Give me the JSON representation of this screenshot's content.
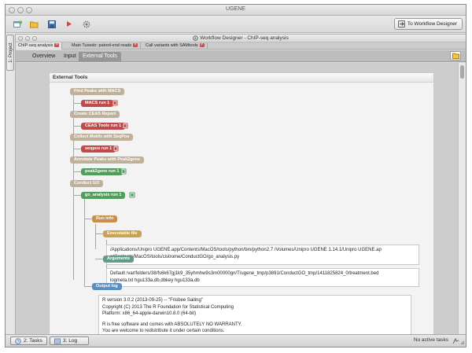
{
  "app": {
    "title": "UGENE"
  },
  "toolbar": {
    "to_wd_label": "To Workflow Designer"
  },
  "side": {
    "project_tab": "1: Project"
  },
  "workflow_window": {
    "title": "Workflow Designer - ChIP-seq analysis",
    "doc_tabs": [
      {
        "label": "ChIP-seq analysis"
      },
      {
        "label": "Main Tuxedo: paired-end reads"
      },
      {
        "label": "Call variants with SAMtools"
      }
    ],
    "view_tabs": [
      "Overview",
      "Input",
      "External Tools"
    ],
    "active_view": "External Tools"
  },
  "panel": {
    "title": "External Tools",
    "steps": [
      {
        "task": "Find Peaks with MACS",
        "run": "MACS run 1",
        "run_color": "red"
      },
      {
        "task": "Create CEAS Report",
        "run": "CEAS Tools run 1",
        "run_color": "red"
      },
      {
        "task": "Collect Motifs with SeqPos",
        "run": "seqpos run 1",
        "run_color": "red"
      },
      {
        "task": "Annotate Peaks with Peak2gene",
        "run": "peak2gene run 1",
        "run_color": "green"
      },
      {
        "task": "Conduct GO",
        "run": "go_analysis run 1",
        "run_color": "green"
      }
    ],
    "run_info_label": "Run info",
    "executable_label": "Executable file",
    "executable_lines": [
      "/Applications/Unipro UGENE.app/Contents/MacOS/tools/python/bin/python2.7 /Volumes/Unipro UGENE 1.14.1/Unipro UGENE.ap",
      "p/Contents/MacOS/tools/cistrome/ConductGO/go_analysis.py"
    ],
    "arguments_label": "Arguments",
    "arguments_lines": [
      "Default /var/folders/38/fs6k67gj1k9_35yhmhw9s3m00000gn/T/ugene_tmp/p3891/ConductGO_tmp/1411825824_0/treatment.bed",
      "logmeta.txt hgu133a.db,dbkey hgu133a.db"
    ],
    "output_label": "Output log",
    "output_lines": [
      "R version 3.0.2 (2013-09-25) -- \"Frisbee Sailing\"",
      "Copyright (C) 2013 The R Foundation for Statistical Computing",
      "Platform: x86_64-apple-darwin10.8.0 (64-bit)",
      "",
      "R is free software and comes with ABSOLUTELY NO WARRANTY.",
      "You are welcome to redistribute it under certain conditions."
    ]
  },
  "statusbar": {
    "tasks_label": "2: Tasks",
    "log_label": "3: Log",
    "status_text": "No active tasks"
  },
  "colors": {
    "task_node": "#bfb09a",
    "run_red": "#c04a4a",
    "run_green": "#4f9e5c",
    "run_info": "#c8904a",
    "executable": "#c9a34f",
    "arguments": "#5f9c8b",
    "output_log": "#5b8fc2"
  }
}
